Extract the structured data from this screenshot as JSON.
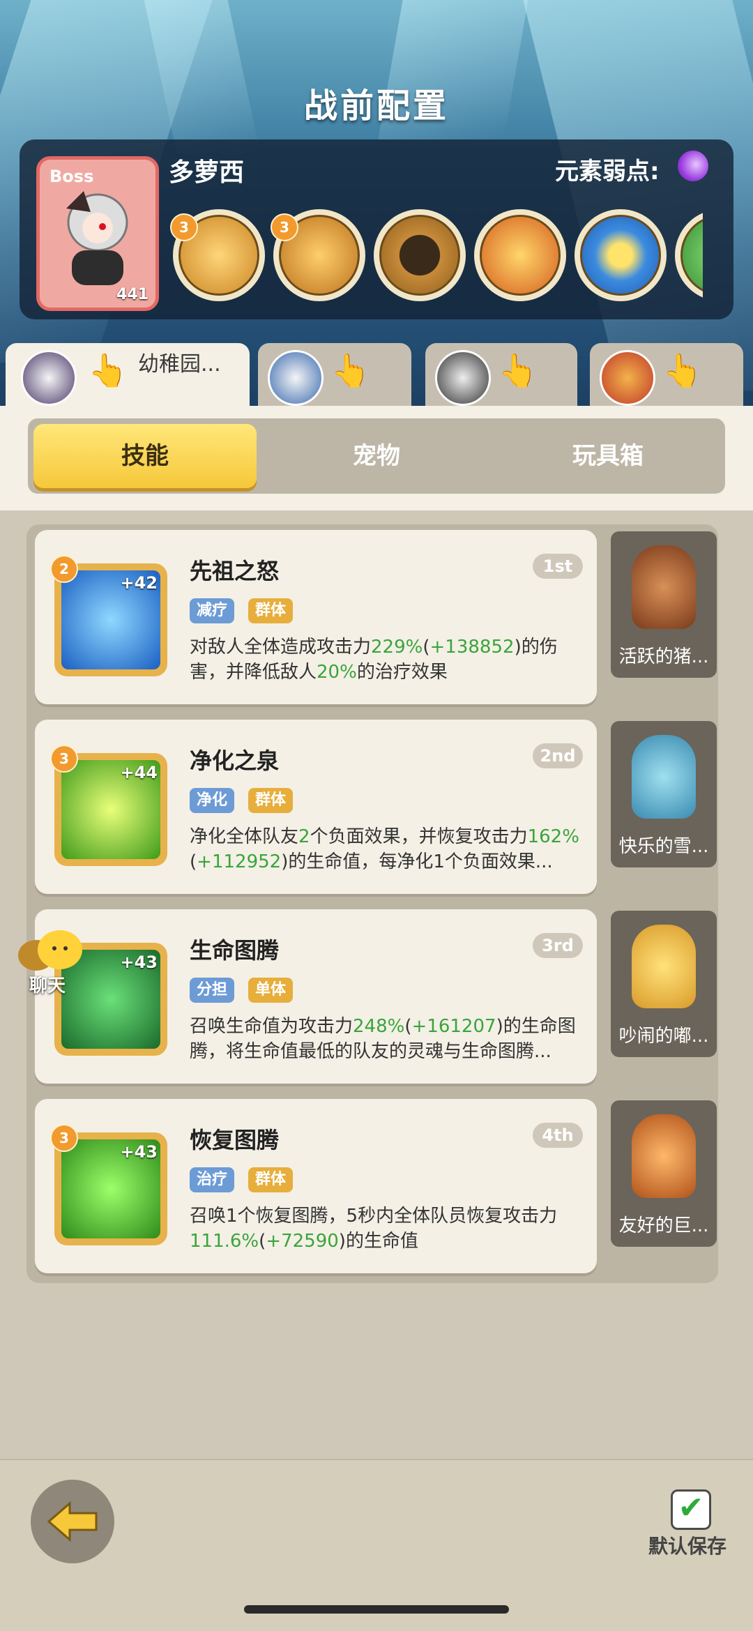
{
  "header": {
    "title": "战前配置"
  },
  "boss": {
    "tag": "Boss",
    "level": "441",
    "name": "多萝西",
    "weakness_label": "元素弱点:",
    "skill_icons": [
      {
        "icon": "golden-sword-icon",
        "badge": "3"
      },
      {
        "icon": "golden-wings-icon",
        "badge": "3"
      },
      {
        "icon": "angry-shadow-icon",
        "badge": ""
      },
      {
        "icon": "fire-swirl-icon",
        "badge": ""
      },
      {
        "icon": "hourglass-icon",
        "badge": ""
      }
    ]
  },
  "team_tabs": [
    {
      "label": "幼稚园..."
    },
    {
      "label": ""
    },
    {
      "label": ""
    },
    {
      "label": ""
    }
  ],
  "segments": {
    "skills": "技能",
    "pets": "宠物",
    "toybox": "玩具箱"
  },
  "skills": [
    {
      "level": "2",
      "plus": "+42",
      "name": "先祖之怒",
      "rank": "1st",
      "tags": [
        "减疗",
        "群体"
      ],
      "desc_parts": [
        "对敌人全体造成攻击力",
        "229%",
        "(",
        "+138852",
        ")的伤害，并降低敌人",
        "20%",
        "的治疗效果"
      ],
      "pet_name": "活跃的猪..."
    },
    {
      "level": "3",
      "plus": "+44",
      "name": "净化之泉",
      "rank": "2nd",
      "tags": [
        "净化",
        "群体"
      ],
      "desc_parts": [
        "净化全体队友",
        "2",
        "个负面效果，并恢复攻击力",
        "162%",
        "(",
        "+112952",
        ")的生命值，每净化1个负面效果..."
      ],
      "pet_name": "快乐的雪..."
    },
    {
      "level": "",
      "plus": "+43",
      "name": "生命图腾",
      "rank": "3rd",
      "tags": [
        "分担",
        "单体"
      ],
      "desc_parts": [
        "召唤生命值为攻击力",
        "248%",
        "(",
        "+161207",
        ")的生命图腾，将生命值最低的队友的灵魂与生命图腾..."
      ],
      "pet_name": "吵闹的嘟..."
    },
    {
      "level": "3",
      "plus": "+43",
      "name": "恢复图腾",
      "rank": "4th",
      "tags": [
        "治疗",
        "群体"
      ],
      "desc_parts": [
        "召唤1个恢复图腾，5秒内全体队员恢复攻击力",
        "111.6%",
        "(",
        "+72590",
        ")的生命值"
      ],
      "pet_name": "友好的巨..."
    }
  ],
  "chat": {
    "label": "聊天"
  },
  "footer": {
    "save_label": "默认保存"
  },
  "colors": {
    "accent_green": "#3aa43a",
    "tab_active": "#f6c83a",
    "boss_red": "#e26a64"
  }
}
